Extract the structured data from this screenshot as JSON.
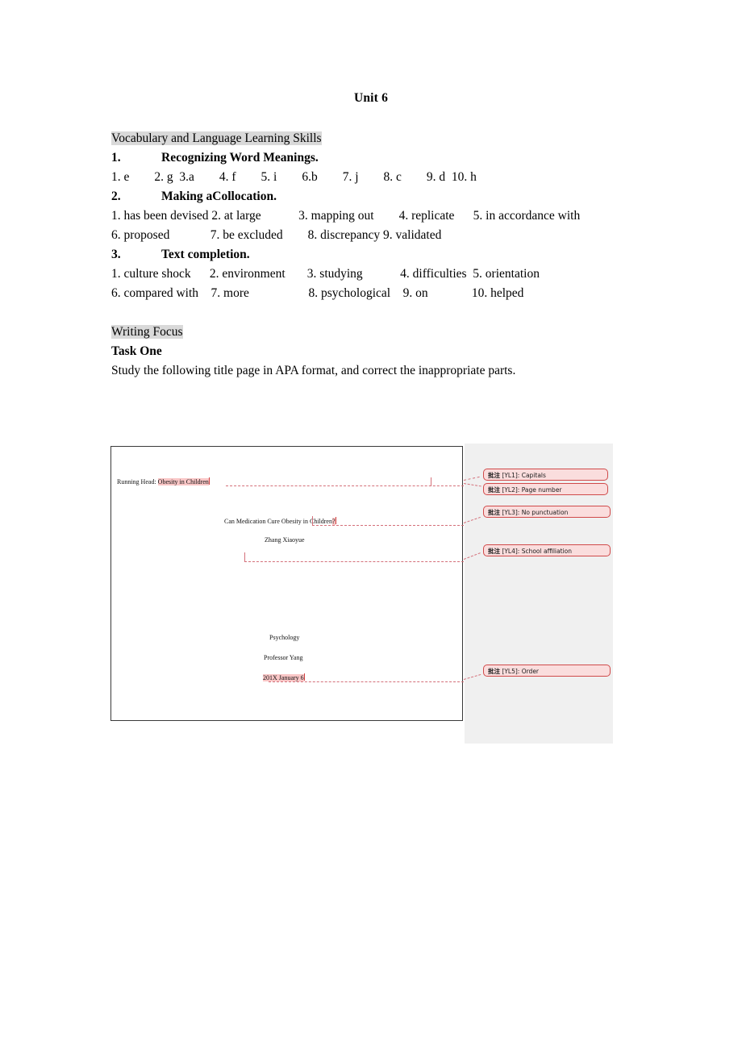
{
  "document": {
    "title": "Unit 6",
    "sections": [
      {
        "heading": "Vocabulary and Language Learning Skills",
        "heading_style": "gray-highlight",
        "items": [
          {
            "number": "1.",
            "label": "Recognizing Word Meanings.",
            "answers": "1. e        2. g  3.a        4. f        5. i        6.b        7. j        8. c        9. d  10. h"
          },
          {
            "number": "2.",
            "label": "Making aCollocation.",
            "answers_line1": "1. has been devised 2. at large            3. mapping out        4. replicate      5. in accordance with",
            "answers_line2": "6. proposed             7. be excluded        8. discrepancy 9. validated"
          },
          {
            "number": "3.",
            "label": "Text completion.",
            "answers_line1": "1. culture shock      2. environment       3. studying            4. difficulties  5. orientation",
            "answers_line2": "6. compared with    7. more                   8. psychological    9. on              10. helped"
          }
        ]
      },
      {
        "heading": "Writing Focus",
        "heading_style": "gray-highlight",
        "task_label": "Task One",
        "task_instruction": "Study the following title page in APA format, and correct the inappropriate parts."
      }
    ]
  },
  "figure": {
    "caption": "annotated APA title page with review comments",
    "sheet": {
      "running_head_label": "Running Head:",
      "running_head_value": "Obesity in Children",
      "paper_title": "Can Medication Cure Obesity in Children",
      "paper_title_punctuation": "?",
      "author": "Zhang Xiaoyue",
      "affiliation": "",
      "department": "Psychology",
      "instructor": "Professor Yang",
      "date": "201X January 6"
    },
    "comments": [
      {
        "id": "YL1",
        "prefix": "批注",
        "bracket": "[YL1]",
        "text": "Capitals"
      },
      {
        "id": "YL2",
        "prefix": "批注",
        "bracket": "[YL2]",
        "text": "Page number"
      },
      {
        "id": "YL3",
        "prefix": "批注",
        "bracket": "[YL3]",
        "text": "No punctuation"
      },
      {
        "id": "YL4",
        "prefix": "批注",
        "bracket": "[YL4]",
        "text": "School affiliation"
      },
      {
        "id": "YL5",
        "prefix": "批注",
        "bracket": "[YL5]",
        "text": "Order"
      }
    ],
    "colors": {
      "comment_fill": "#fadddd",
      "comment_border": "#d04a4a",
      "leader_line": "#d4707a",
      "highlight_pink": "#f9c6c6",
      "highlight_gray": "#d9d9d9",
      "pane_background": "#f0f0f0"
    }
  }
}
